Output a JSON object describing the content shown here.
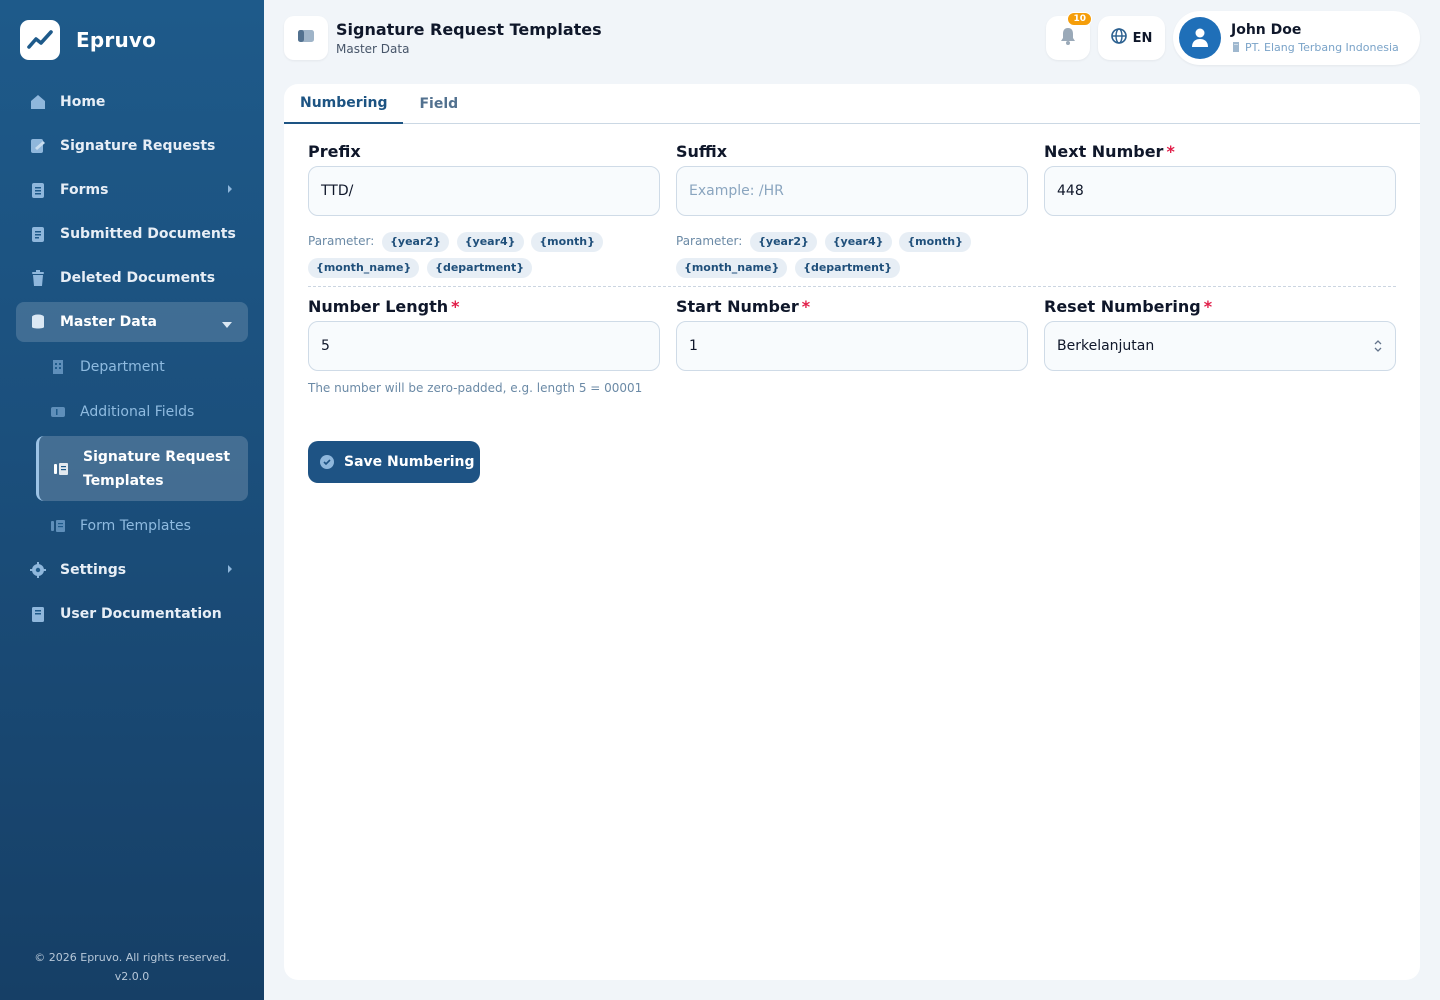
{
  "app": {
    "name": "Epruvo",
    "footer_copyright": "© 2026 Epruvo. All rights reserved.",
    "version": "v2.0.0"
  },
  "sidebar": {
    "items": [
      {
        "label": "Home",
        "icon": "home-icon"
      },
      {
        "label": "Signature Requests",
        "icon": "signature-icon"
      },
      {
        "label": "Forms",
        "icon": "clipboard-icon"
      },
      {
        "label": "Submitted Documents",
        "icon": "document-icon"
      },
      {
        "label": "Deleted Documents",
        "icon": "trash-icon"
      },
      {
        "label": "Master Data",
        "icon": "database-icon"
      }
    ],
    "sub_items": [
      {
        "label": "Department",
        "icon": "building-icon"
      },
      {
        "label": "Additional Fields",
        "icon": "field-icon"
      },
      {
        "label": "Signature Request Templates",
        "icon": "template-icon"
      },
      {
        "label": "Form Templates",
        "icon": "template-icon"
      }
    ],
    "bottom_items": [
      {
        "label": "Settings",
        "icon": "gear-icon"
      },
      {
        "label": "User Documentation",
        "icon": "book-icon"
      }
    ]
  },
  "header": {
    "title": "Signature Request Templates",
    "subtitle": "Master Data",
    "notifications_count": "10",
    "language": "EN",
    "user": {
      "name": "John Doe",
      "company": "PT. Elang Terbang Indonesia"
    }
  },
  "tabs": [
    "Numbering",
    "Field"
  ],
  "form": {
    "prefix": {
      "label": "Prefix",
      "value": "TTD/"
    },
    "suffix": {
      "label": "Suffix",
      "value": "",
      "placeholder": "Example: /HR"
    },
    "next_number": {
      "label": "Next Number",
      "value": "448"
    },
    "number_length": {
      "label": "Number Length",
      "value": "5",
      "hint": "The number will be zero-padded, e.g. length 5 = 00001"
    },
    "start_number": {
      "label": "Start Number",
      "value": "1"
    },
    "reset_numbering": {
      "label": "Reset Numbering",
      "value": "Berkelanjutan"
    },
    "parameter_label": "Parameter:",
    "parameters": [
      "{year2}",
      "{year4}",
      "{month}",
      "{month_name}",
      "{department}"
    ],
    "save_label": "Save Numbering"
  },
  "colors": {
    "sidebar": "#1b4f7c",
    "primary": "#1e5384",
    "required": "#e11d48",
    "badge": "#f59e0b"
  }
}
